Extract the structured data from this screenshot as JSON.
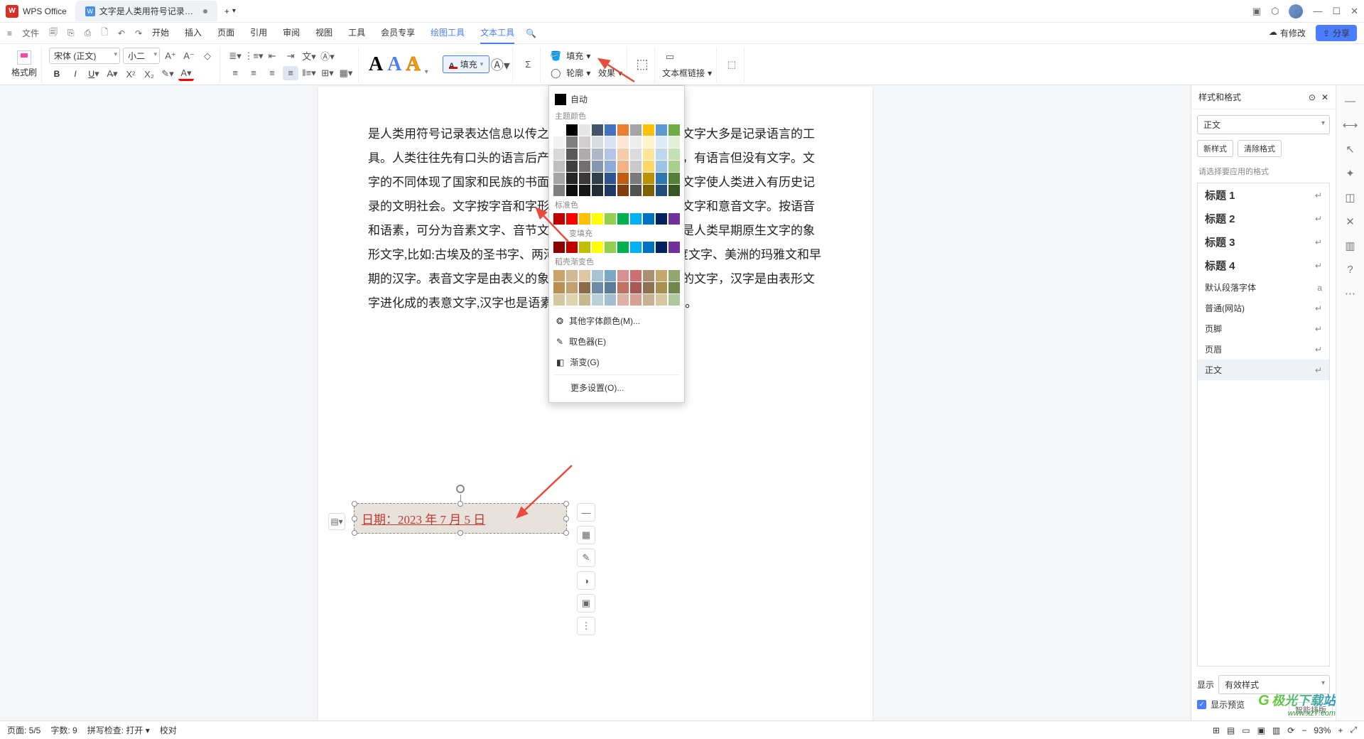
{
  "titlebar": {
    "app": "WPS Office",
    "tab_title": "文字是人类用符号记录表达信息以",
    "add": "+"
  },
  "menubar": {
    "file": "文件",
    "tabs": [
      "开始",
      "插入",
      "页面",
      "引用",
      "审阅",
      "视图",
      "工具",
      "会员专享",
      "绘图工具",
      "文本工具"
    ],
    "active": "文本工具",
    "has_changes": "有修改",
    "share": "分享"
  },
  "ribbon": {
    "format_brush": "格式刷",
    "font_name": "宋体 (正文)",
    "font_size": "小二",
    "fill": "填充",
    "outline": "轮廓",
    "effect": "效果",
    "shape_fill": "填充",
    "textbox_link": "文本框链接"
  },
  "color_popup": {
    "auto": "自动",
    "theme": "主题颜色",
    "standard": "标准色",
    "gradient_fill": "变填充",
    "preset_grad": "稻壳渐变色",
    "more_colors": "其他字体颜色(M)...",
    "eyedropper": "取色器(E)",
    "gradient": "渐变(G)",
    "more_settings": "更多设置(O)...",
    "theme_row1": [
      "#ffffff",
      "#000000",
      "#e7e6e6",
      "#44546a",
      "#4472c4",
      "#ed7d31",
      "#a5a5a5",
      "#ffc000",
      "#5b9bd5",
      "#70ad47"
    ],
    "theme_shades": [
      [
        "#f2f2f2",
        "#7f7f7f",
        "#d0cece",
        "#d6dce4",
        "#d9e2f3",
        "#fbe5d5",
        "#ededed",
        "#fff2cc",
        "#deebf6",
        "#e2efd9"
      ],
      [
        "#d8d8d8",
        "#595959",
        "#aeabab",
        "#adb9ca",
        "#b4c6e7",
        "#f7cbac",
        "#dbdbdb",
        "#fee599",
        "#bdd7ee",
        "#c5e0b3"
      ],
      [
        "#bfbfbf",
        "#3f3f3f",
        "#757070",
        "#8496b0",
        "#8eaadb",
        "#f4b183",
        "#c9c9c9",
        "#ffd965",
        "#9cc3e5",
        "#a8d08d"
      ],
      [
        "#a5a5a5",
        "#262626",
        "#3a3838",
        "#323f4f",
        "#2f5496",
        "#c55a11",
        "#7b7b7b",
        "#bf9000",
        "#2e75b5",
        "#538135"
      ],
      [
        "#7f7f7f",
        "#0c0c0c",
        "#171616",
        "#222a35",
        "#1f3864",
        "#833c0b",
        "#525252",
        "#7f6000",
        "#1e4e79",
        "#375623"
      ]
    ],
    "standard_row": [
      "#c00000",
      "#ff0000",
      "#ffc000",
      "#ffff00",
      "#92d050",
      "#00b050",
      "#00b0f0",
      "#0070c0",
      "#002060",
      "#7030a0"
    ],
    "grad_row": [
      "#8b0000",
      "#c00000",
      "#bfbf00",
      "#ffff00",
      "#92d050",
      "#00b050",
      "#00b0f0",
      "#0070c0",
      "#002060",
      "#7030a0"
    ],
    "preset_rows": [
      [
        "#c9a56b",
        "#d4b896",
        "#e0c7a3",
        "#a8c4d4",
        "#7ba8c4",
        "#d89090",
        "#cc7070",
        "#a89070",
        "#c4a870",
        "#90a870"
      ],
      [
        "#b89050",
        "#c4a070",
        "#8b6b4b",
        "#6b8ba8",
        "#5b7b98",
        "#c47060",
        "#a85850",
        "#907050",
        "#a89050",
        "#708850"
      ],
      [
        "#d4c8a0",
        "#e0d4b0",
        "#c8b890",
        "#b8d0d8",
        "#a0c0d0",
        "#e0b0a8",
        "#d8a090",
        "#c8b090",
        "#d8c8a0",
        "#b0c8a0"
      ]
    ]
  },
  "document": {
    "paragraph": "是人类用符号记录表达信息以传之久远的方式和工具。现代文字大多是记录语言的工具。人类往往先有口头的语言后产生书面文字，很多小语种，有语言但没有文字。文字的不同体现了国家和民族的书面表达的方式和思维不同。文字使人类进入有历史记录的文明社会。文字按字音和字形，可分为表形文字、表音文字和意音文字。按语音和语素，可分为音素文字、音节文字和语素文字。表形文字是人类早期原生文字的象形文字,比如:古埃及的圣书字、两河流域的楔形文字、古印度文字、美洲的玛雅文和早期的汉字。表音文字是由表义的象形符号和表音的声旁组成的文字，汉字是由表形文字进化成的表意文字,汉字也是语素文字，也是一种二维文字。",
    "textbox": "日期：2023 年 7 月 5 日"
  },
  "right_panel": {
    "title": "样式和格式",
    "current": "正文",
    "new_style": "新样式",
    "clear": "清除格式",
    "hint": "请选择要应用的格式",
    "styles": [
      {
        "name": "标题 1",
        "big": true
      },
      {
        "name": "标题 2",
        "big": true
      },
      {
        "name": "标题 3",
        "big": true
      },
      {
        "name": "标题 4",
        "big": true
      },
      {
        "name": "默认段落字体",
        "big": false,
        "mark": "a"
      },
      {
        "name": "普通(网站)",
        "big": false
      },
      {
        "name": "页脚",
        "big": false
      },
      {
        "name": "页眉",
        "big": false
      },
      {
        "name": "正文",
        "big": false,
        "sel": true
      }
    ],
    "show": "显示",
    "show_val": "有效样式",
    "preview": "显示预览",
    "smart": "智能排版"
  },
  "statusbar": {
    "page": "页面: 5/5",
    "words": "字数: 9",
    "spell": "拼写检查: 打开",
    "proof": "校对",
    "zoom": "93%"
  },
  "watermark": {
    "brand": "极光下载站",
    "url": "www.xz7.com"
  }
}
